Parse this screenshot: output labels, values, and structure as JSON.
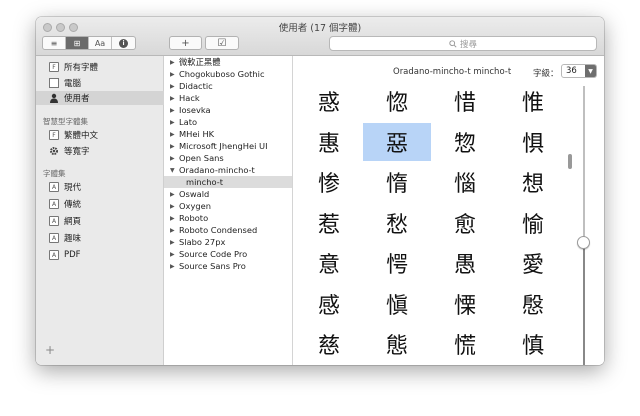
{
  "window": {
    "title": "使用者 (17 個字體)"
  },
  "toolbar": {
    "view_buttons": [
      "≡",
      "⊞",
      "Aa",
      "i"
    ],
    "add_label": "+",
    "check_label": "☑",
    "search_placeholder": "搜尋"
  },
  "sidebar": {
    "items": [
      {
        "label": "所有字體",
        "icon": "F"
      },
      {
        "label": "電腦",
        "icon": "▭"
      },
      {
        "label": "使用者",
        "icon": "person"
      }
    ],
    "smart_heading": "智慧型字體集",
    "smart_items": [
      {
        "label": "繁體中文",
        "icon": "F"
      },
      {
        "label": "等寬字",
        "icon": "gear"
      }
    ],
    "collections_heading": "字體集",
    "collections": [
      {
        "label": "現代",
        "icon": "A"
      },
      {
        "label": "傳統",
        "icon": "A"
      },
      {
        "label": "網頁",
        "icon": "A"
      },
      {
        "label": "趣味",
        "icon": "A"
      },
      {
        "label": "PDF",
        "icon": "A"
      }
    ],
    "add_label": "+"
  },
  "fonts": [
    {
      "label": "微軟正黑體",
      "expanded": false
    },
    {
      "label": "Chogokuboso Gothic",
      "expanded": false
    },
    {
      "label": "Didactic",
      "expanded": false
    },
    {
      "label": "Hack",
      "expanded": false
    },
    {
      "label": "Iosevka",
      "expanded": false
    },
    {
      "label": "Lato",
      "expanded": false
    },
    {
      "label": "MHei HK",
      "expanded": false
    },
    {
      "label": "Microsoft JhengHei UI",
      "expanded": false
    },
    {
      "label": "Open Sans",
      "expanded": false
    },
    {
      "label": "Oradano-mincho-t",
      "expanded": true
    },
    {
      "label": "mincho-t",
      "sub": true
    },
    {
      "label": "Oswald",
      "expanded": false
    },
    {
      "label": "Oxygen",
      "expanded": false
    },
    {
      "label": "Roboto",
      "expanded": false
    },
    {
      "label": "Roboto Condensed",
      "expanded": false
    },
    {
      "label": "Slabo 27px",
      "expanded": false
    },
    {
      "label": "Source Code Pro",
      "expanded": false
    },
    {
      "label": "Source Sans Pro",
      "expanded": false
    }
  ],
  "preview": {
    "font_name": "Oradano-mincho-t mincho-t",
    "size_label": "字級：",
    "size_value": "36",
    "glyphs": [
      "惑",
      "惚",
      "惜",
      "惟",
      "惠",
      "惡",
      "惣",
      "惧",
      "惨",
      "惰",
      "惱",
      "想",
      "惹",
      "愁",
      "愈",
      "愉",
      "意",
      "愕",
      "愚",
      "愛",
      "感",
      "愼",
      "慄",
      "慇",
      "慈",
      "態",
      "慌",
      "慎"
    ],
    "selected_index": 5
  }
}
